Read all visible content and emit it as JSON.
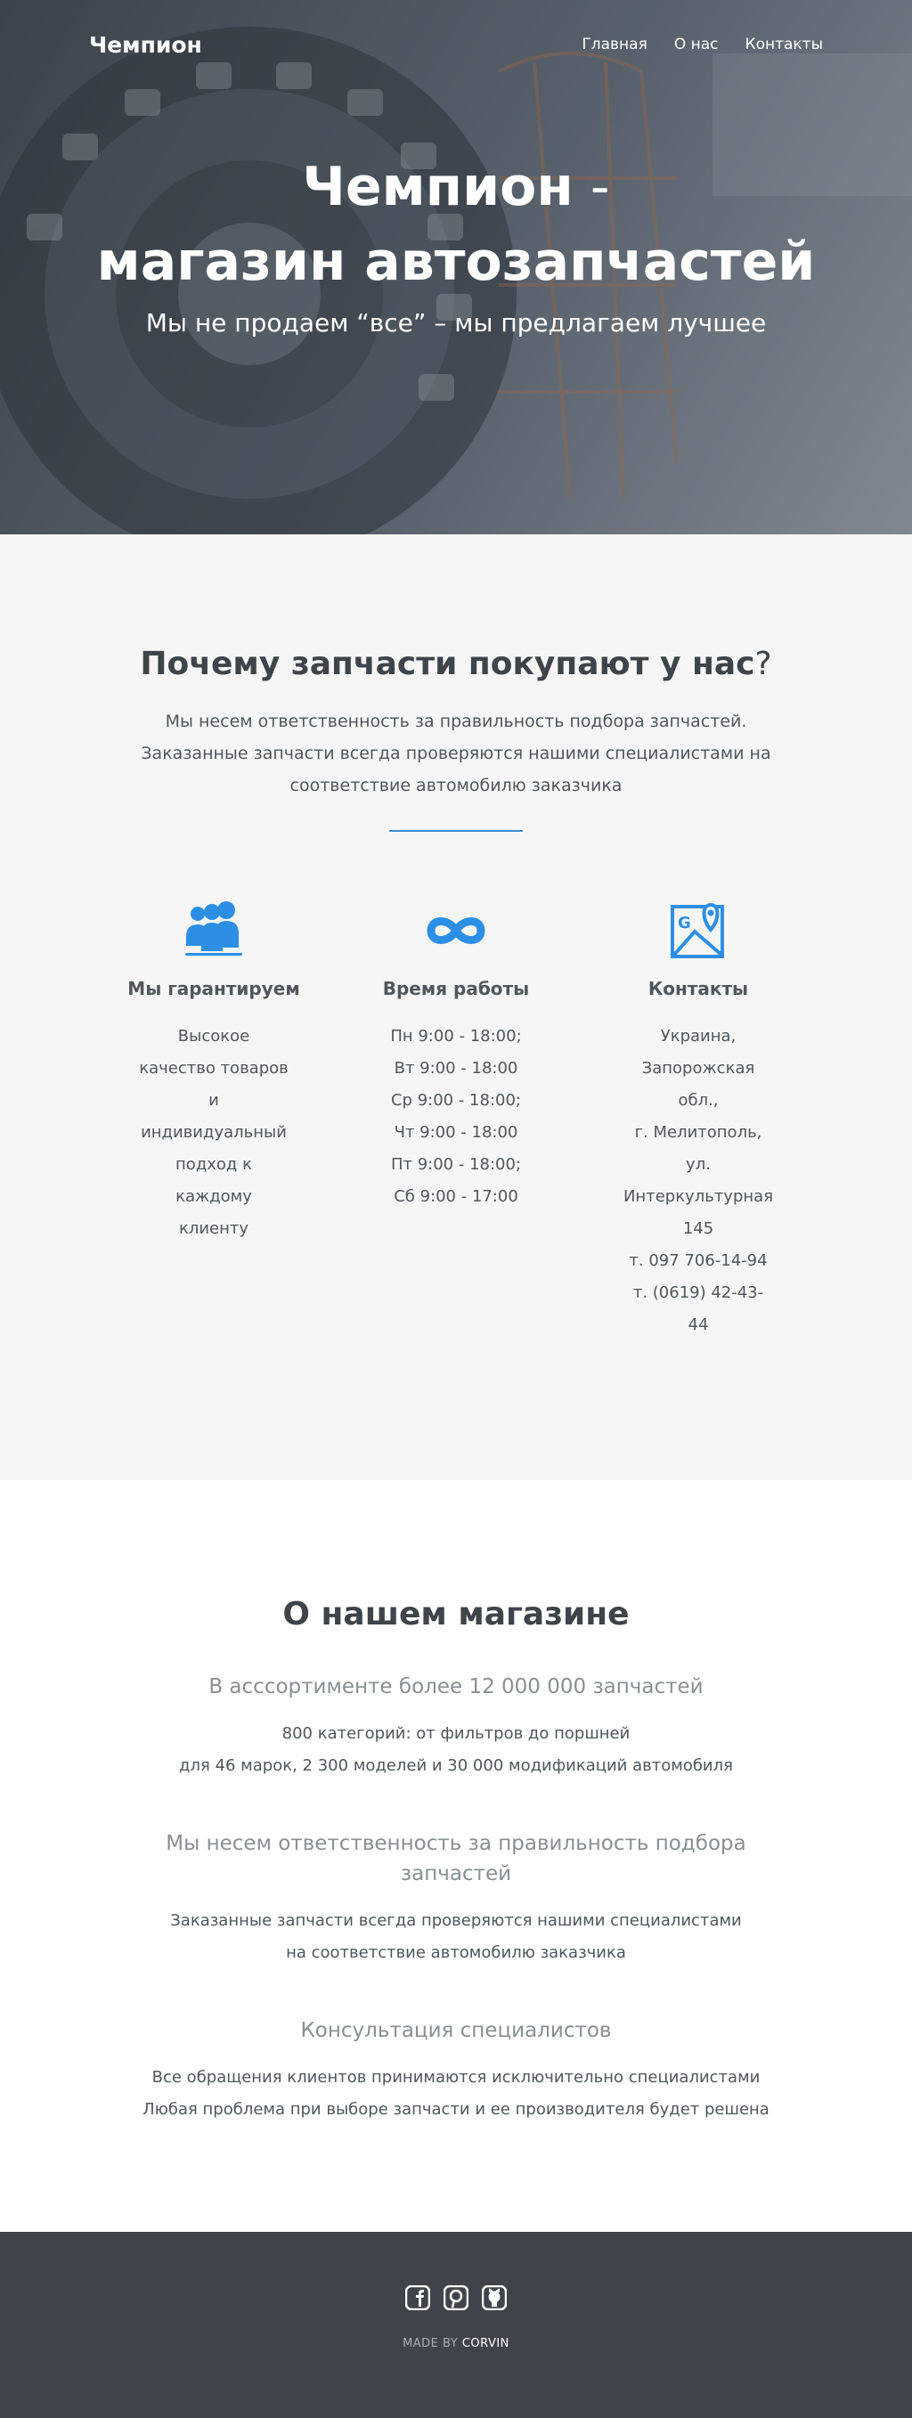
{
  "header": {
    "brand": "Чемпион",
    "nav": [
      "Главная",
      "О нас",
      "Контакты"
    ]
  },
  "hero": {
    "title_line1": "Чемпион",
    "title_dash": " -",
    "title_line2": "магазин автозапчастей",
    "subtitle": "Мы не продаем “все” – мы предлагаем лучшее"
  },
  "why": {
    "title": "Почему запчасти покупают у нас",
    "title_mark": "?",
    "desc_lines": [
      "Мы несем ответственность за правильность подбора запчастей.",
      "Заказанные запчасти всегда проверяются нашими специалистами на",
      "соответствие автомобилю заказчика"
    ],
    "features": [
      {
        "icon": "users-icon",
        "title": "Мы гарантируем",
        "lines": [
          "Высокое",
          "качество товаров",
          "и",
          "индивидуальный",
          "подход к",
          "каждому",
          "клиенту"
        ]
      },
      {
        "icon": "infinity-icon",
        "title": "Время работы",
        "lines": [
          "Пн 9:00 - 18:00;",
          "Вт 9:00 - 18:00",
          "Ср 9:00 - 18:00;",
          "Чт 9:00 - 18:00",
          "Пт 9:00 - 18:00;",
          "Сб 9:00 - 17:00"
        ]
      },
      {
        "icon": "map-icon",
        "title": "Контакты",
        "lines": [
          "Украина,",
          "Запорожская",
          "обл.,",
          "г. Мелитополь,",
          "ул.",
          "Интеркультурная",
          "145",
          "т. 097 706-14-94",
          "т. (0619) 42-43-",
          "44"
        ]
      }
    ]
  },
  "about": {
    "title": "О нашем магазине",
    "blocks": [
      {
        "subtitle": "В асссортименте более 12 000 000 запчастей",
        "lines": [
          "800 категорий: от фильтров до поршней",
          "для 46 марок, 2 300 моделей и 30 000 модификаций автомобиля"
        ]
      },
      {
        "subtitle": "Мы несем ответственность за правильность подбора запчастей",
        "lines": [
          "Заказанные запчасти всегда проверяются нашими специалистами",
          "на соответствие автомобилю заказчика"
        ]
      },
      {
        "subtitle": "Консультация специалистов",
        "lines": [
          "Все обращения клиентов принимаются исключительно специалистами",
          "Любая проблема при выборе запчасти и ее производителя будет решена"
        ]
      }
    ]
  },
  "footer": {
    "social": [
      "facebook-icon",
      "pinterest-icon",
      "github-icon"
    ],
    "made_by": "MADE BY",
    "author": "CORVIN"
  },
  "colors": {
    "accent": "#3b8fd9",
    "icon_blue": "#2d8ee6",
    "footer_bg": "#3f444b",
    "section_bg": "#f6f6f6"
  }
}
